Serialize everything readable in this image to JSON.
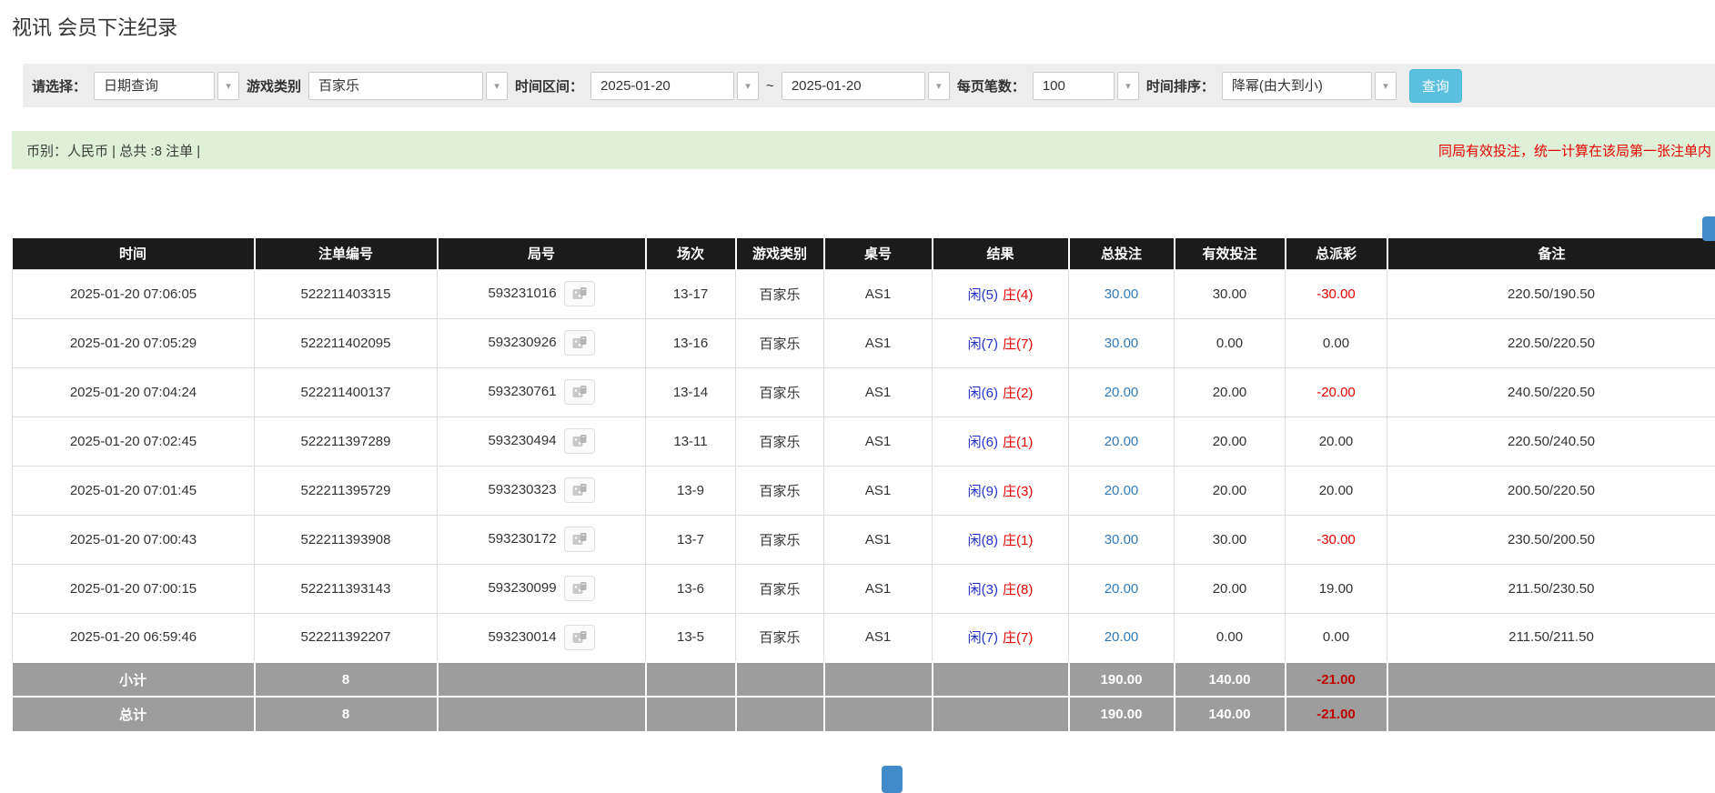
{
  "colors": {
    "accent": "#5bc0de",
    "accent_border": "#46b8da",
    "link": "#337ab7",
    "player_blue": "#2233cc",
    "banker_red": "#e60000",
    "negative_red": "#e60000",
    "header_bg": "#1b1b1b",
    "footer_bg": "#9d9d9d",
    "notice_bg": "#dff0d8",
    "notice_text": "#e60000",
    "filter_bg": "#ededed"
  },
  "page": {
    "title": "视讯 会员下注纪录"
  },
  "filters": {
    "select_label": "请选择：",
    "select_value": "日期查询",
    "game_label": "游戏类别",
    "game_value": "百家乐",
    "range_label": "时间区间：",
    "date_from": "2025-01-20",
    "range_separator": "~",
    "date_to": "2025-01-20",
    "page_size_label": "每页笔数：",
    "page_size_value": "100",
    "sort_label": "时间排序：",
    "sort_value": "降幂(由大到小)",
    "search_label": "查询"
  },
  "summary": {
    "info": "币别：人民币 | 总共 :8 注单 |",
    "notice": "同局有效投注，统一计算在该局第一张注单内"
  },
  "table": {
    "headers": [
      "时间",
      "注单编号",
      "局号",
      "场次",
      "游戏类别",
      "桌号",
      "结果",
      "总投注",
      "有效投注",
      "总派彩",
      "备注"
    ],
    "rows": [
      {
        "time": "2025-01-20 07:06:05",
        "bet_id": "522211403315",
        "round_id": "593231016",
        "session": "13-17",
        "game": "百家乐",
        "table_no": "AS1",
        "player": "闲(5)",
        "banker": "庄(4)",
        "total_bet": "30.00",
        "valid_bet": "30.00",
        "payout": "-30.00",
        "remark": "220.50/190.50"
      },
      {
        "time": "2025-01-20 07:05:29",
        "bet_id": "522211402095",
        "round_id": "593230926",
        "session": "13-16",
        "game": "百家乐",
        "table_no": "AS1",
        "player": "闲(7)",
        "banker": "庄(7)",
        "total_bet": "30.00",
        "valid_bet": "0.00",
        "payout": "0.00",
        "remark": "220.50/220.50"
      },
      {
        "time": "2025-01-20 07:04:24",
        "bet_id": "522211400137",
        "round_id": "593230761",
        "session": "13-14",
        "game": "百家乐",
        "table_no": "AS1",
        "player": "闲(6)",
        "banker": "庄(2)",
        "total_bet": "20.00",
        "valid_bet": "20.00",
        "payout": "-20.00",
        "remark": "240.50/220.50"
      },
      {
        "time": "2025-01-20 07:02:45",
        "bet_id": "522211397289",
        "round_id": "593230494",
        "session": "13-11",
        "game": "百家乐",
        "table_no": "AS1",
        "player": "闲(6)",
        "banker": "庄(1)",
        "total_bet": "20.00",
        "valid_bet": "20.00",
        "payout": "20.00",
        "remark": "220.50/240.50"
      },
      {
        "time": "2025-01-20 07:01:45",
        "bet_id": "522211395729",
        "round_id": "593230323",
        "session": "13-9",
        "game": "百家乐",
        "table_no": "AS1",
        "player": "闲(9)",
        "banker": "庄(3)",
        "total_bet": "20.00",
        "valid_bet": "20.00",
        "payout": "20.00",
        "remark": "200.50/220.50"
      },
      {
        "time": "2025-01-20 07:00:43",
        "bet_id": "522211393908",
        "round_id": "593230172",
        "session": "13-7",
        "game": "百家乐",
        "table_no": "AS1",
        "player": "闲(8)",
        "banker": "庄(1)",
        "total_bet": "30.00",
        "valid_bet": "30.00",
        "payout": "-30.00",
        "remark": "230.50/200.50"
      },
      {
        "time": "2025-01-20 07:00:15",
        "bet_id": "522211393143",
        "round_id": "593230099",
        "session": "13-6",
        "game": "百家乐",
        "table_no": "AS1",
        "player": "闲(3)",
        "banker": "庄(8)",
        "total_bet": "20.00",
        "valid_bet": "20.00",
        "payout": "19.00",
        "remark": "211.50/230.50"
      },
      {
        "time": "2025-01-20 06:59:46",
        "bet_id": "522211392207",
        "round_id": "593230014",
        "session": "13-5",
        "game": "百家乐",
        "table_no": "AS1",
        "player": "闲(7)",
        "banker": "庄(7)",
        "total_bet": "20.00",
        "valid_bet": "0.00",
        "payout": "0.00",
        "remark": "211.50/211.50"
      }
    ],
    "footer_rows": [
      {
        "label": "小计",
        "count": "8",
        "total_bet": "190.00",
        "valid_bet": "140.00",
        "payout": "-21.00"
      },
      {
        "label": "总计",
        "count": "8",
        "total_bet": "190.00",
        "valid_bet": "140.00",
        "payout": "-21.00"
      }
    ]
  }
}
